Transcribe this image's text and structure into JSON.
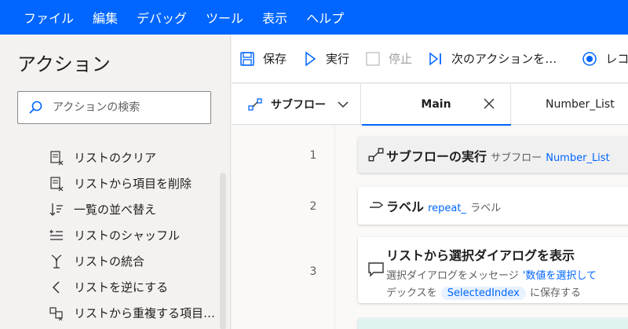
{
  "menu": [
    "ファイル",
    "編集",
    "デバッグ",
    "ツール",
    "表示",
    "ヘルプ"
  ],
  "left_panel": {
    "title": "アクション",
    "search_placeholder": "アクションの検索",
    "items": [
      {
        "label": "リストのクリア",
        "icon": "clear-list-icon"
      },
      {
        "label": "リストから項目を削除",
        "icon": "remove-item-icon"
      },
      {
        "label": "一覧の並べ替え",
        "icon": "sort-icon"
      },
      {
        "label": "リストのシャッフル",
        "icon": "shuffle-icon"
      },
      {
        "label": "リストの統合",
        "icon": "merge-icon"
      },
      {
        "label": "リストを逆にする",
        "icon": "reverse-icon"
      },
      {
        "label": "リストから重複する項目…",
        "icon": "dedupe-icon"
      }
    ]
  },
  "toolbar": {
    "save": "保存",
    "run": "実行",
    "stop": "停止",
    "next": "次のアクションを…",
    "record": "レコ"
  },
  "tabs": {
    "subflows": "サブフロー",
    "main": "Main",
    "number_list": "Number_List"
  },
  "steps": [
    {
      "line": "1",
      "title": "サブフローの実行",
      "desc_prefix": "サブフロー",
      "desc_value": "Number_List"
    },
    {
      "line": "2",
      "title": "ラベル",
      "desc_value": "repeat_",
      "desc_suffix": "ラベル"
    },
    {
      "line": "3",
      "title": "リストから選択ダイアログを表示",
      "desc_line1_prefix": "選択ダイアログをメッセージ",
      "desc_line1_value": "'数値を選択して",
      "desc_line2_prefix": "デックスを",
      "desc_line2_chip": "SelectedIndex",
      "desc_line2_suffix": "に保存する"
    }
  ],
  "colors": {
    "accent": "#0066ff",
    "menubar": "#0066ff"
  }
}
